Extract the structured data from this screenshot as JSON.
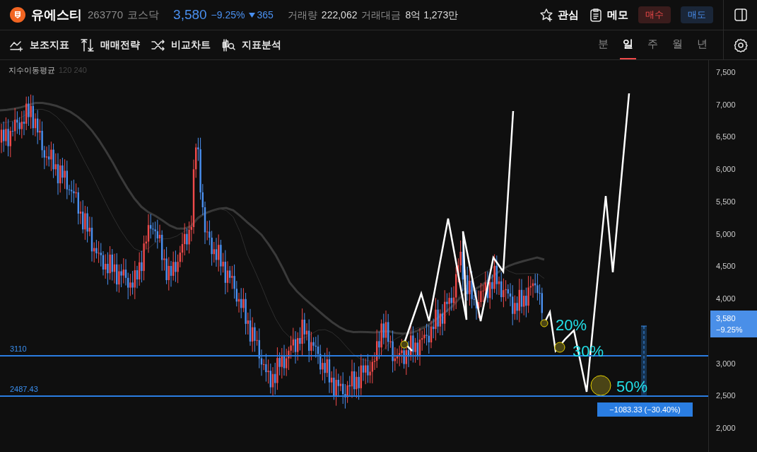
{
  "header": {
    "name": "유에스티",
    "code": "263770",
    "market": "코스닥",
    "price": "3,580",
    "change_pct": "−9.25%",
    "change": "365",
    "volume_label": "거래량",
    "volume": "222,062",
    "amount_label": "거래대금",
    "amount": "8억 1,273만"
  },
  "actions": [
    {
      "kind": "star",
      "label": "관심"
    },
    {
      "kind": "memo",
      "label": "메모"
    }
  ],
  "trade_buttons": [
    {
      "kind": "buy",
      "label": "매수"
    },
    {
      "kind": "sell",
      "label": "매도"
    }
  ],
  "toolbar": [
    {
      "kind": "indicator",
      "label": "보조지표"
    },
    {
      "kind": "strategy",
      "label": "매매전략"
    },
    {
      "kind": "compare",
      "label": "비교차트"
    },
    {
      "kind": "analysis",
      "label": "지표분석"
    }
  ],
  "timeframes": [
    {
      "label": "분",
      "selected": false
    },
    {
      "label": "일",
      "selected": true
    },
    {
      "label": "주",
      "selected": false
    },
    {
      "label": "월",
      "selected": false
    },
    {
      "label": "년",
      "selected": false
    }
  ],
  "chart": {
    "indicator": {
      "name": "지수이동평균",
      "params": "120 240"
    },
    "axis_labels": [
      "7,500",
      "7,000",
      "6,500",
      "6,000",
      "5,500",
      "5,000",
      "4,500",
      "4,000",
      "3,000",
      "2,500",
      "2,000"
    ],
    "current_price": {
      "price": "3,580",
      "change": "−9.25%"
    },
    "levels": [
      {
        "label": "3110"
      },
      {
        "label": "2487.43"
      }
    ],
    "annotations": [
      "20%",
      "30%",
      "50%"
    ],
    "measure": "−1083.33 (−30.40%)"
  }
}
